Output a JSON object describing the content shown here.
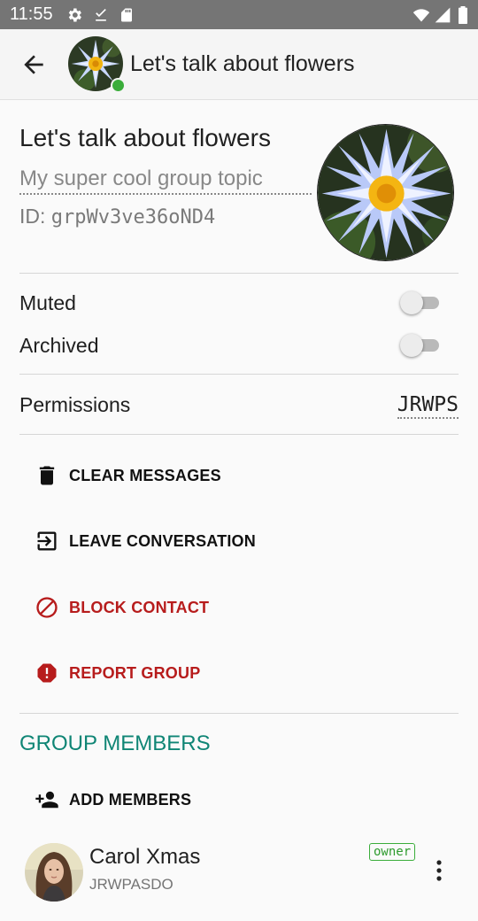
{
  "status_bar": {
    "time": "11:55",
    "left_icons": [
      "gear-icon",
      "download-done-icon",
      "sd-card-icon"
    ],
    "right_icons": [
      "wifi-icon",
      "signal-icon",
      "battery-icon"
    ]
  },
  "app_bar": {
    "title": "Let's talk about flowers",
    "back_icon": "arrow-back-icon",
    "online": true
  },
  "group": {
    "name": "Let's talk about flowers",
    "topic": "My super cool group topic",
    "id_label": "ID:",
    "id_value": "grpWv3ve36oND4"
  },
  "settings": {
    "muted_label": "Muted",
    "muted": false,
    "archived_label": "Archived",
    "archived": false,
    "permissions_label": "Permissions",
    "permissions_value": "JRWPS"
  },
  "actions": [
    {
      "label": "CLEAR MESSAGES",
      "icon": "trash-icon",
      "color": "#111111"
    },
    {
      "label": "LEAVE CONVERSATION",
      "icon": "exit-icon",
      "color": "#111111"
    },
    {
      "label": "BLOCK CONTACT",
      "icon": "block-icon",
      "color": "#b71c1c"
    },
    {
      "label": "REPORT GROUP",
      "icon": "report-icon",
      "color": "#b71c1c"
    }
  ],
  "members_section": {
    "title": "GROUP MEMBERS",
    "add_label": "ADD MEMBERS",
    "members": [
      {
        "name": "Carol Xmas",
        "permissions": "JRWPASDO",
        "badge": "owner"
      }
    ]
  },
  "colors": {
    "accent": "#0f8575",
    "danger": "#b71c1c",
    "online": "#3aad3a",
    "status_bar": "#757575"
  }
}
